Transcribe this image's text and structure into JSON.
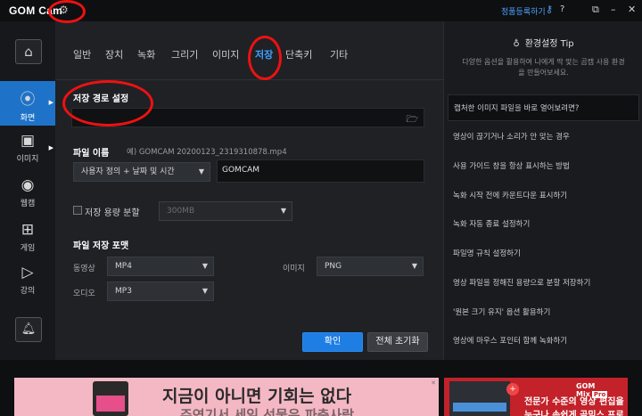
{
  "app": {
    "logo_text": "GOM Cam",
    "register_link": "정품등록하기"
  },
  "sidebar": {
    "items": [
      {
        "label": "화면",
        "active": true
      },
      {
        "label": "이미지",
        "active": false
      },
      {
        "label": "웹캠",
        "active": false
      },
      {
        "label": "게임",
        "active": false
      },
      {
        "label": "강의",
        "active": false
      }
    ]
  },
  "tabs": [
    "일반",
    "장치",
    "녹화",
    "그리기",
    "이미지",
    "저장",
    "단축키",
    "기타"
  ],
  "active_tab": "저장",
  "save": {
    "path_title": "저장 경로 설정",
    "path_value": "",
    "filename_title": "파일 이름",
    "filename_example": "예) GOMCAM 20200123_2319310878.mp4",
    "filename_mode": "사용자 정의 + 날짜 및 시간",
    "filename_prefix": "GOMCAM",
    "capacity_split_label": "저장 용량 분할",
    "capacity_split_checked": false,
    "capacity_value": "300MB",
    "format_title": "파일 저장 포맷",
    "video_label": "동영상",
    "video_format": "MP4",
    "audio_label": "오디오",
    "audio_format": "MP3",
    "image_label": "이미지",
    "image_format": "PNG",
    "ok_button": "확인",
    "reset_button": "전체 초기화"
  },
  "tips": {
    "title": "환경설정 Tip",
    "description": "다양한 옵션을 활용하여 나에게 딱 맞는 곰캠 사용 환경을 만들어보세요.",
    "items": [
      "캡처한 이미지 파일을 바로 열어보려면?",
      "영상이 끊기거나 소리가 안 맞는 경우",
      "사용 가이드 창을 항상 표시하는 방법",
      "녹화 시작 전에 카운트다운 표시하기",
      "녹화 자동 종료 설정하기",
      "파일명 규칙 설정하기",
      "영상 파일을 정해진 용량으로 분할 저장하기",
      "'원본 크기 유지' 옵션 활용하기",
      "영상에 마우스 포인터 함께 녹화하기"
    ]
  },
  "ads": {
    "left_headline": "지금이 아니면 기회는 없다",
    "left_subline": "주연기서 세일 선물은 파충사랑",
    "right_brand": "GOM Mix",
    "right_brand_tag": "Pro",
    "right_copy1": "전문가 수준의 영상 편집을",
    "right_copy2": "누구나 손쉽게 곰믹스 프로"
  },
  "colors": {
    "accent": "#1e73c9",
    "tab_active": "#3fa1ff",
    "annotation": "#ee1111"
  }
}
